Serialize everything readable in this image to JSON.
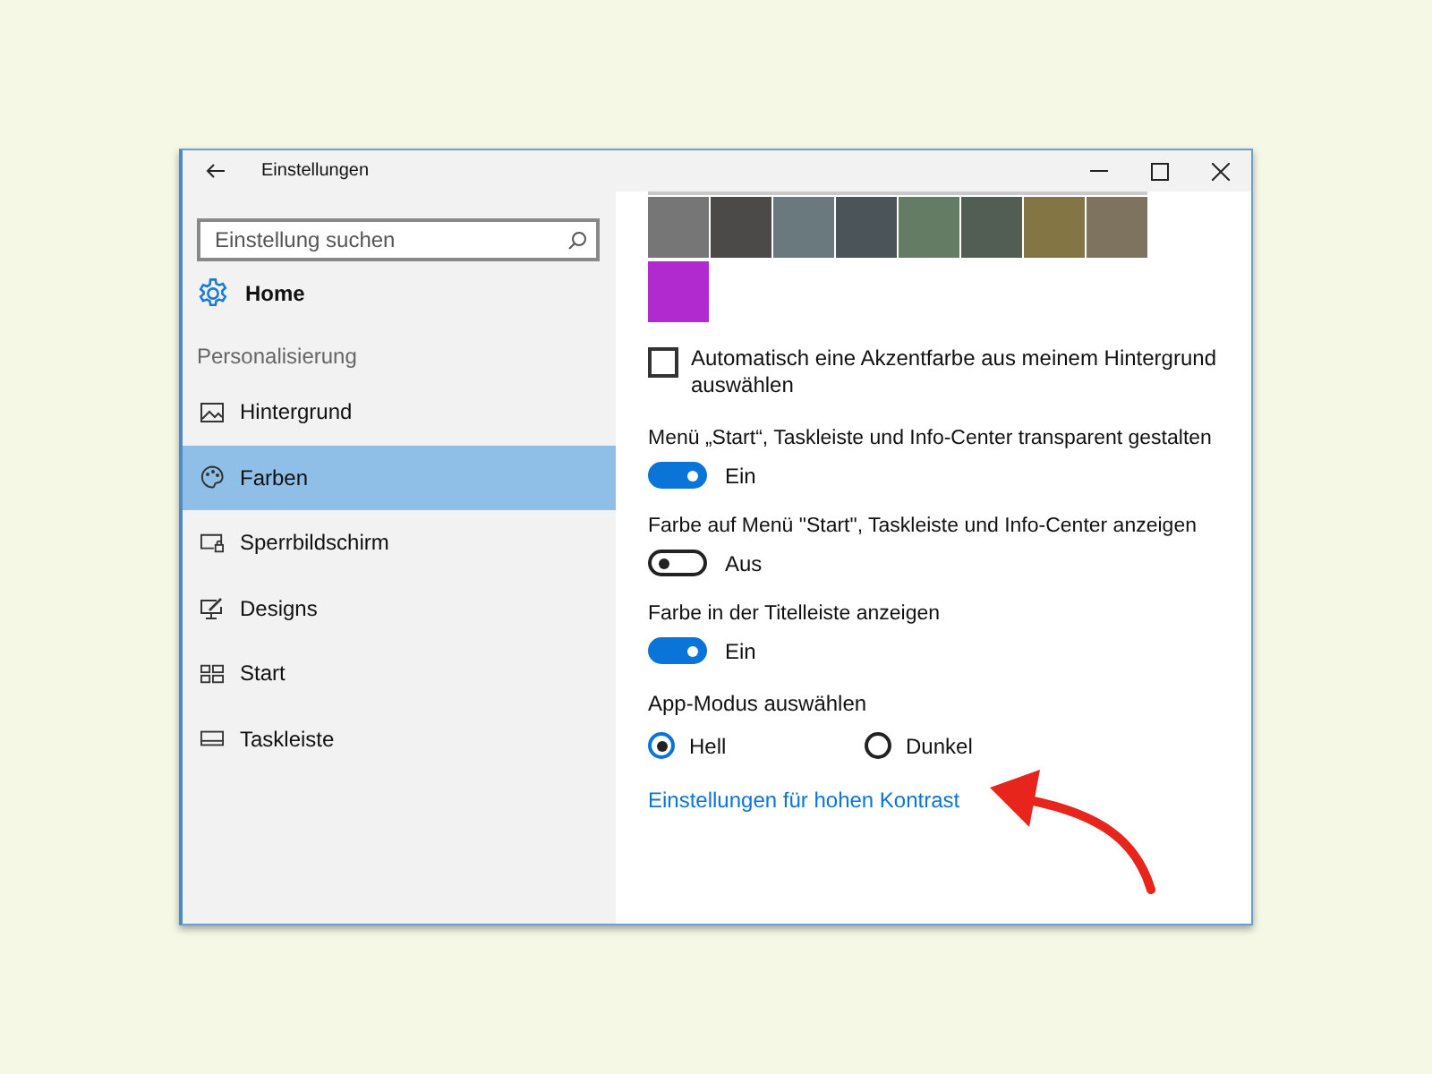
{
  "window": {
    "title": "Einstellungen"
  },
  "search": {
    "placeholder": "Einstellung suchen"
  },
  "home": "Home",
  "section": "Personalisierung",
  "nav": [
    {
      "label": "Hintergrund",
      "selected": false
    },
    {
      "label": "Farben",
      "selected": true
    },
    {
      "label": "Sperrbildschirm",
      "selected": false
    },
    {
      "label": "Designs",
      "selected": false
    },
    {
      "label": "Start",
      "selected": false
    },
    {
      "label": "Taskleiste",
      "selected": false
    }
  ],
  "accent_colors": [
    {
      "color": "#767676"
    },
    {
      "color": "#4c4a48"
    },
    {
      "color": "#69797e"
    },
    {
      "color": "#4a5459"
    },
    {
      "color": "#647c64"
    },
    {
      "color": "#525e54"
    },
    {
      "color": "#847545"
    },
    {
      "color": "#7e735f"
    },
    {
      "color": "#b12ad0"
    }
  ],
  "auto_accent": {
    "label": "Automatisch eine Akzentfarbe aus meinem Hintergrund auswählen",
    "checked": false
  },
  "toggles": [
    {
      "label": "Menü „Start“, Taskleiste und Info-Center transparent gestalten",
      "on": true,
      "state_text": "Ein"
    },
    {
      "label": "Farbe auf Menü \"Start\", Taskleiste und Info-Center anzeigen",
      "on": false,
      "state_text": "Aus"
    },
    {
      "label": "Farbe in der Titelleiste anzeigen",
      "on": true,
      "state_text": "Ein"
    }
  ],
  "app_mode": {
    "label": "App-Modus auswählen",
    "options": [
      {
        "label": "Hell",
        "selected": true
      },
      {
        "label": "Dunkel",
        "selected": false
      }
    ]
  },
  "link": "Einstellungen für hohen Kontrast"
}
